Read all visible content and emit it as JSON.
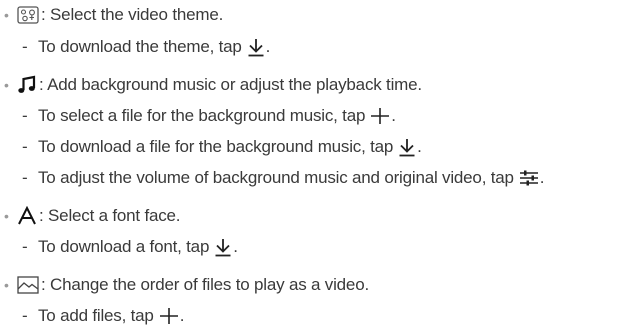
{
  "items": [
    {
      "icon": "theme-icon",
      "text": ": Select the video theme.",
      "subs": [
        {
          "before": "To download the theme, tap",
          "icon": "download-icon",
          "after": "."
        }
      ]
    },
    {
      "icon": "music-note-icon",
      "text": ": Add background music or adjust the playback time.",
      "subs": [
        {
          "before": "To select a file for the background music, tap",
          "icon": "add-icon",
          "after": "."
        },
        {
          "before": "To download a file for the background music, tap",
          "icon": "download-icon",
          "after": "."
        },
        {
          "before": "To adjust the volume of background music and original video, tap",
          "icon": "volume-adjust-icon",
          "after": "."
        }
      ]
    },
    {
      "icon": "font-icon",
      "text": ": Select a font face.",
      "subs": [
        {
          "before": "To download a font, tap",
          "icon": "download-icon",
          "after": "."
        }
      ]
    },
    {
      "icon": "image-icon",
      "text": ": Change the order of files to play as a video.",
      "subs": [
        {
          "before": "To add files, tap",
          "icon": "add-icon",
          "after": "."
        }
      ]
    }
  ]
}
